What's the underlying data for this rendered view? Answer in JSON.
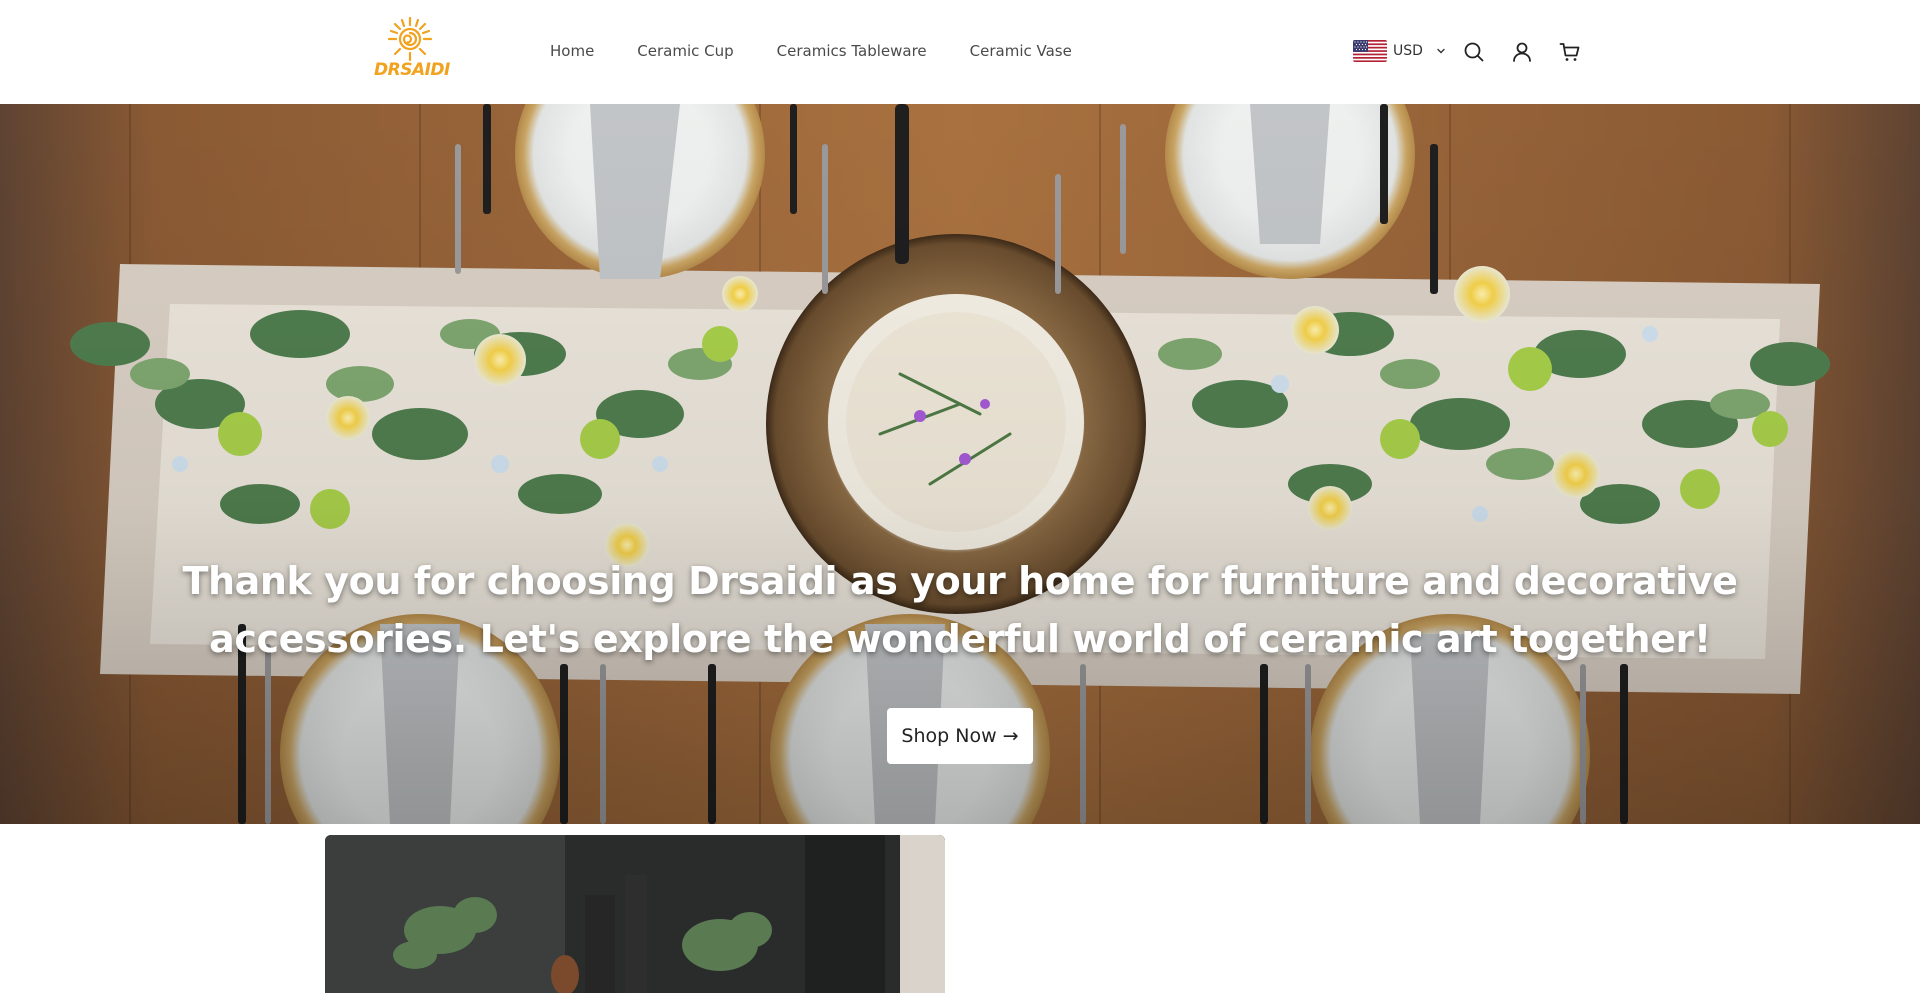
{
  "brand": {
    "name": "DRSAIDI",
    "accent": "#f1a21e"
  },
  "nav": {
    "items": [
      {
        "label": "Home"
      },
      {
        "label": "Ceramic Cup"
      },
      {
        "label": "Ceramics Tableware"
      },
      {
        "label": "Ceramic Vase"
      }
    ]
  },
  "header": {
    "currency": {
      "label": "USD",
      "flag": "us-flag-icon"
    },
    "icons": [
      "search-icon",
      "account-icon",
      "cart-icon"
    ]
  },
  "hero": {
    "headline": "Thank you for choosing Drsaidi as your home for furniture and decorative accessories. Let's explore the wonderful world of ceramic art together!",
    "cta_label": "Shop Now →"
  }
}
